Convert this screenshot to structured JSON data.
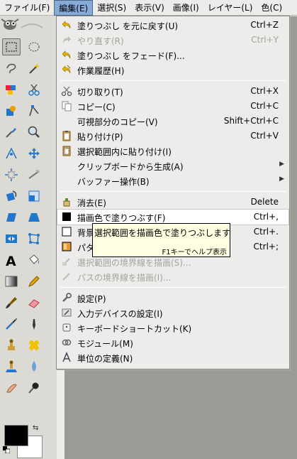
{
  "menubar": {
    "items": [
      {
        "label": "ファイル(F)"
      },
      {
        "label": "編集(E)"
      },
      {
        "label": "選択(S)"
      },
      {
        "label": "表示(V)"
      },
      {
        "label": "画像(I)"
      },
      {
        "label": "レイヤー(L)"
      },
      {
        "label": "色(C)"
      }
    ]
  },
  "edit_menu": {
    "undo": {
      "label": "塗りつぶし を元に戻す(U)",
      "shortcut": "Ctrl+Z"
    },
    "redo": {
      "label": "やり直す(R)",
      "shortcut": "Ctrl+Y"
    },
    "fade": {
      "label": "塗りつぶし をフェード(F)..."
    },
    "history": {
      "label": "作業履歴(H)"
    },
    "cut": {
      "label": "切り取り(T)",
      "shortcut": "Ctrl+X"
    },
    "copy": {
      "label": "コピー(C)",
      "shortcut": "Ctrl+C"
    },
    "copy_visible": {
      "label": "可視部分のコピー(V)",
      "shortcut": "Shift+Ctrl+C"
    },
    "paste": {
      "label": "貼り付け(P)",
      "shortcut": "Ctrl+V"
    },
    "paste_into": {
      "label": "選択範囲内に貼り付け(I)"
    },
    "paste_as_new": {
      "label": "クリップボードから生成(A)"
    },
    "buffer": {
      "label": "バッファー操作(B)"
    },
    "clear": {
      "label": "消去(E)",
      "shortcut": "Delete"
    },
    "fill_fg": {
      "label": "描画色で塗りつぶす(F)",
      "shortcut": "Ctrl+,"
    },
    "fill_bg": {
      "label": "背景",
      "shortcut": "Ctrl+."
    },
    "fill_pattern": {
      "label": "パタ",
      "shortcut": "Ctrl+;"
    },
    "stroke_selection": {
      "label": "選択範囲の境界線を描画(S)..."
    },
    "stroke_path": {
      "label": "パスの境界線を描画(I)..."
    },
    "preferences": {
      "label": "設定(P)"
    },
    "input_devices": {
      "label": "入力デバイスの設定(I)"
    },
    "keyboard_shortcuts": {
      "label": "キーボードショートカット(K)"
    },
    "modules": {
      "label": "モジュール(M)"
    },
    "units": {
      "label": "単位の定義(N)"
    }
  },
  "tooltip": {
    "text": "選択範囲を描画色で塗りつぶします",
    "help": "F1キーでヘルプ表示"
  },
  "colors": {
    "foreground": "#000000",
    "background": "#ffffff",
    "menu_highlight": "#86abd9"
  }
}
